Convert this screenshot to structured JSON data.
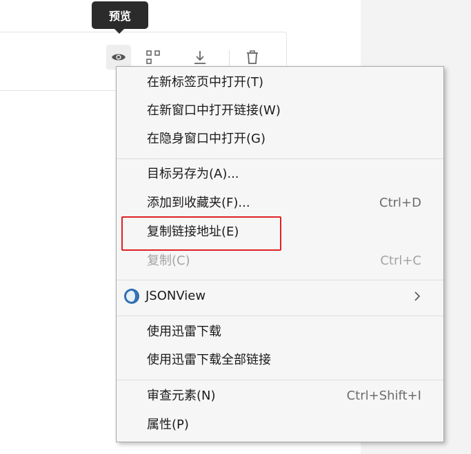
{
  "tooltip": {
    "text": "预览"
  },
  "toolbar": {
    "icons": [
      "eye-icon",
      "scan-icon",
      "download-icon",
      "trash-icon"
    ]
  },
  "menu": {
    "group1": [
      {
        "label": "在新标签页中打开(T)"
      },
      {
        "label": "在新窗口中打开链接(W)"
      },
      {
        "label": "在隐身窗口中打开(G)"
      }
    ],
    "group2": [
      {
        "label": "目标另存为(A)...",
        "shortcut": ""
      },
      {
        "label": "添加到收藏夹(F)...",
        "shortcut": "Ctrl+D"
      },
      {
        "label": "复制链接地址(E)",
        "shortcut": "",
        "highlighted": true
      },
      {
        "label": "复制(C)",
        "shortcut": "Ctrl+C",
        "disabled": true
      }
    ],
    "group3": [
      {
        "label": "JSONView",
        "icon": "jsonview-icon",
        "submenu": true
      }
    ],
    "group4": [
      {
        "label": "使用迅雷下载"
      },
      {
        "label": "使用迅雷下载全部链接"
      }
    ],
    "group5": [
      {
        "label": "审查元素(N)",
        "shortcut": "Ctrl+Shift+I"
      },
      {
        "label": "属性(P)"
      }
    ]
  },
  "colors": {
    "highlight_border": "#e02020",
    "menu_bg": "#f6f6f6",
    "tooltip_bg": "#2b2b2b"
  }
}
